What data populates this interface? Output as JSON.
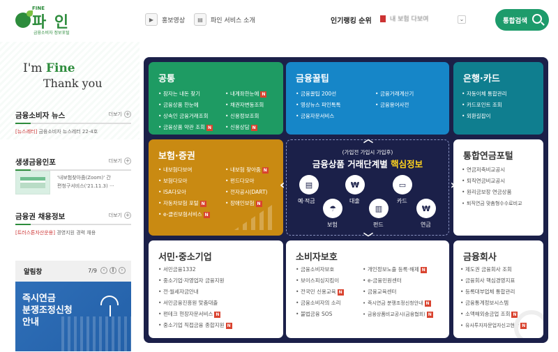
{
  "header": {
    "logo_small": "FINE",
    "logo": "파 인",
    "logo_sub": "금융소비자 정보포털",
    "nav": [
      {
        "label": "홍보영상",
        "icon": "play-icon"
      },
      {
        "label": "파인 서비스 소개",
        "icon": "document-icon"
      }
    ],
    "ranking_label": "인기랭킹 순위",
    "ranking_item": "내 보험 다보여",
    "search_label": "통합검색"
  },
  "left": {
    "greeting_1": "I'm",
    "greeting_brand": "Fine",
    "greeting_2": "Thank you",
    "news": {
      "title": "금융소비자 뉴스",
      "more": "더보기",
      "tag": "[뉴스레터]",
      "text": "금융소비자 뉴스레터 22-4호"
    },
    "insurance": {
      "title": "생생금융인포",
      "more": "더보기",
      "text_1": "'내보험찾아줌(Zoom)' 간",
      "text_2": "편청구서비스('21.11.3) ···"
    },
    "recruit": {
      "title": "금융권 채용정보",
      "more": "더보기",
      "tag": "[트러스톤자산운용]",
      "text": "경영지원 경력 채용"
    },
    "alarm": {
      "title": "알림창",
      "page": "7/9",
      "banner_1": "즉시연금",
      "banner_2": "분쟁조정신청",
      "banner_3": "안내"
    }
  },
  "cards": {
    "common": {
      "title": "공통",
      "col1": [
        {
          "label": "잠자는 내돈 찾기"
        },
        {
          "label": "금융상품 한눈에"
        },
        {
          "label": "상속인 금융거래조회"
        },
        {
          "label": "금융상품 약관 조회",
          "new": "N"
        }
      ],
      "col2": [
        {
          "label": "내계좌한눈에",
          "new": "N"
        },
        {
          "label": "채권자변동조회"
        },
        {
          "label": "신용정보조회"
        },
        {
          "label": "신용상담",
          "new": "N"
        }
      ]
    },
    "tips": {
      "title": "금융꿀팁",
      "col1": [
        {
          "label": "금융꿀팁 200선"
        },
        {
          "label": "영상뉴스 파인톡톡"
        },
        {
          "label": "금융자문서비스"
        }
      ],
      "col2": [
        {
          "label": "금융거래계산기"
        },
        {
          "label": "금융용어사전"
        }
      ]
    },
    "bank": {
      "title": "은행·카드",
      "items": [
        {
          "label": "자동이체 통합관리"
        },
        {
          "label": "카드포인트 조회"
        },
        {
          "label": "외환길잡이"
        }
      ]
    },
    "insurance": {
      "title": "보험·증권",
      "col1": [
        {
          "label": "내보험다보여"
        },
        {
          "label": "보험다모아"
        },
        {
          "label": "ISA다모아"
        },
        {
          "label": "자동차보험 포털",
          "new": "N"
        },
        {
          "label": "e-클린보험서비스",
          "new": "N"
        }
      ],
      "col2": [
        {
          "label": "내보험 찾아줌",
          "new": "N"
        },
        {
          "label": "펀드다모아"
        },
        {
          "label": "전자공시(DART)"
        },
        {
          "label": "장애인보험",
          "new": "N"
        }
      ]
    },
    "core": {
      "sub": "(가입전 가입시 가입후)",
      "title_1": "금융상품 거래단계별",
      "title_hl": "핵심정보",
      "items": [
        {
          "label": "예·적금",
          "icon": "deposit-icon",
          "glyph": "▤"
        },
        {
          "label": "대출",
          "icon": "loan-icon",
          "glyph": "₩"
        },
        {
          "label": "카드",
          "icon": "card-icon",
          "glyph": "▭"
        },
        {
          "label": "보험",
          "icon": "umbrella-icon",
          "glyph": "☂"
        },
        {
          "label": "펀드",
          "icon": "chart-icon",
          "glyph": "▥"
        },
        {
          "label": "연금",
          "icon": "pension-icon",
          "glyph": "₩"
        }
      ]
    },
    "pension": {
      "title": "통합연금포털",
      "items": [
        {
          "label": "연금저축비교공시"
        },
        {
          "label": "퇴직연금비교공시"
        },
        {
          "label": "원리금보장 연금상품"
        },
        {
          "label": "퇴직연금 맞춤형수수료비교"
        }
      ]
    },
    "smb": {
      "title": "서민·중소기업",
      "items": [
        {
          "label": "서민금융1332"
        },
        {
          "label": "중소기업·자영업자 금융지원"
        },
        {
          "label": "전·월세자금안내"
        },
        {
          "label": "서민금융진흥원 맞춤대출"
        },
        {
          "label": "펀테크 현장자문서비스",
          "new": "N"
        },
        {
          "label": "중소기업 직접금융 종합지원",
          "new": "N"
        }
      ]
    },
    "consumer": {
      "title": "소비자보호",
      "col1": [
        {
          "label": "금융소비자보호"
        },
        {
          "label": "보이스피싱지킴이"
        },
        {
          "label": "전국민 신용교육",
          "new": "N"
        },
        {
          "label": "금융소비자의 소리"
        },
        {
          "label": "불법금융 SOS"
        }
      ],
      "col2": [
        {
          "label": "개인정보노출 등록·해제",
          "new": "N"
        },
        {
          "label": "e-금융민원센터"
        },
        {
          "label": "금융교육센터"
        },
        {
          "label": "즉시연금 분쟁조정신청안내",
          "new": "N"
        },
        {
          "label": "금융상품비교공시(금융협회)",
          "new": "N"
        }
      ]
    },
    "companies": {
      "title": "금융회사",
      "items": [
        {
          "label": "제도권 금융회사 조회"
        },
        {
          "label": "금융회사 핵심경영지표"
        },
        {
          "label": "등록대부업체 통합관리"
        },
        {
          "label": "금융통계정보시스템"
        },
        {
          "label": "소액해외송금업 조회",
          "new": "N"
        },
        {
          "label": "유사투자자문업자신고현황",
          "new": "N"
        }
      ]
    }
  }
}
